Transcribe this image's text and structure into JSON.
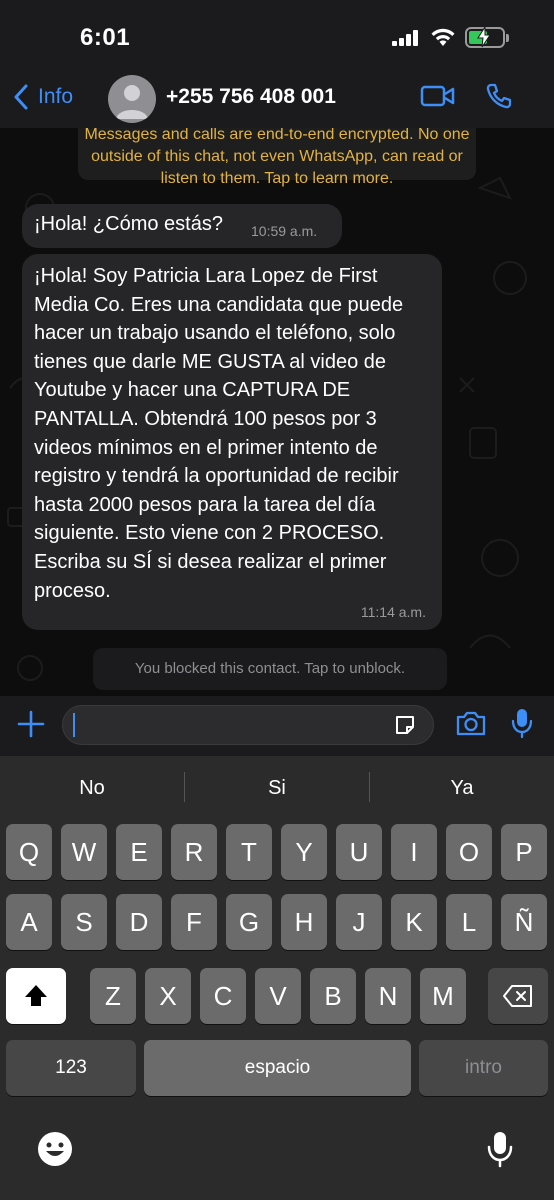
{
  "status_bar": {
    "time": "6:01"
  },
  "nav": {
    "back_label": "Info",
    "contact_name": "+255 756 408 001"
  },
  "encryption_notice": {
    "text": "Messages and calls are end-to-end encrypted. No one outside of this chat, not even WhatsApp, can read or listen to them. Tap to learn more."
  },
  "messages": [
    {
      "text": "¡Hola! ¿Cómo estás?",
      "time": "10:59 a.m."
    },
    {
      "text": "¡Hola! Soy Patricia Lara Lopez de First Media Co. Eres una candidata que puede hacer un trabajo usando el teléfono, solo tienes que darle ME GUSTA al video de Youtube y hacer una CAPTURA DE PANTALLA. Obtendrá 100 pesos por 3 videos mínimos en el primer intento de registro y tendrá la oportunidad de recibir hasta 2000 pesos para la tarea del día siguiente. Esto viene con 2 PROCESO. Escriba su SÍ si desea realizar el primer proceso.",
      "time": "11:14 a.m."
    }
  ],
  "blocked_banner": "You blocked this contact. Tap to unblock.",
  "composer": {
    "value": ""
  },
  "keyboard": {
    "suggestions": [
      "No",
      "Si",
      "Ya"
    ],
    "row1": [
      "Q",
      "W",
      "E",
      "R",
      "T",
      "Y",
      "U",
      "I",
      "O",
      "P"
    ],
    "row2": [
      "A",
      "S",
      "D",
      "F",
      "G",
      "H",
      "J",
      "K",
      "L",
      "Ñ"
    ],
    "row3": [
      "Z",
      "X",
      "C",
      "V",
      "B",
      "N",
      "M"
    ],
    "numbers_label": "123",
    "space_label": "espacio",
    "return_label": "intro"
  },
  "colors": {
    "accent": "#3e8ef7",
    "notice_text": "#e3b341",
    "bubble": "#262628",
    "battery": "#34c759"
  }
}
